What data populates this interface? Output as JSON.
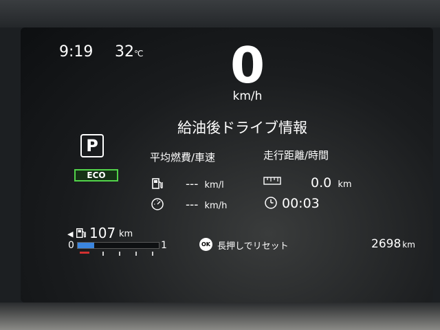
{
  "status": {
    "clock": "9:19",
    "temperature_value": "32",
    "temperature_unit": "℃"
  },
  "speed": {
    "value": "0",
    "unit": "km/h"
  },
  "gear": {
    "position": "P",
    "mode_badge": "ECO"
  },
  "trip": {
    "title": "給油後ドライブ情報",
    "left_header": "平均燃費/車速",
    "right_header": "走行距離/時間",
    "fuel_economy": {
      "value": "---",
      "unit": "km/l",
      "icon": "fuel-pump-icon"
    },
    "avg_speed": {
      "value": "---",
      "unit": "km/h",
      "icon": "speedometer-icon"
    },
    "distance": {
      "value": "0.0",
      "unit": "km",
      "icon": "ruler-icon"
    },
    "time": {
      "value": "00:03",
      "icon": "clock-icon"
    }
  },
  "range": {
    "arrow": "◀",
    "value": "107",
    "unit": "km",
    "icon": "fuel-pump-icon",
    "gauge_min": "0",
    "gauge_max": "1",
    "fuel_level_fraction": 0.2
  },
  "reset_hint": {
    "button": "OK",
    "label": "長押しでリセット"
  },
  "odometer": {
    "value": "2698",
    "unit": "km"
  },
  "colors": {
    "eco_border": "#52d44a",
    "fuel_bar": "#3b86e0",
    "low_fuel_mark": "#d23030"
  }
}
